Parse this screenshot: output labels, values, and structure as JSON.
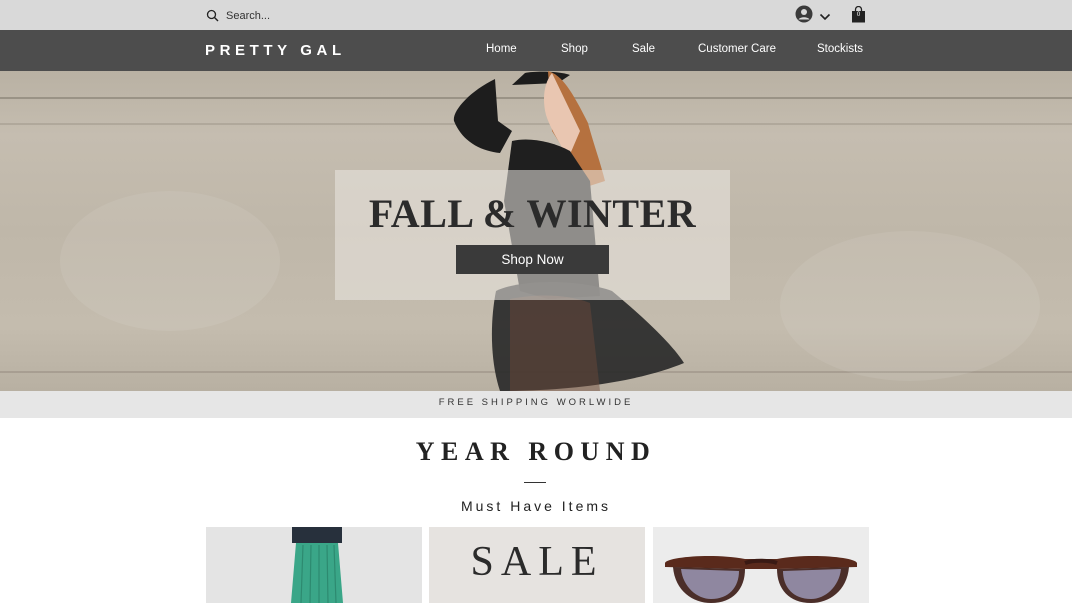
{
  "search": {
    "placeholder": "Search..."
  },
  "account": {
    "icon": "account-circle-icon",
    "dropdown_icon": "chevron-down-icon"
  },
  "cart": {
    "icon": "shopping-bag-icon",
    "count": "0"
  },
  "brand": {
    "name": "PRETTY GAL"
  },
  "nav": {
    "items": [
      {
        "label": "Home"
      },
      {
        "label": "Shop"
      },
      {
        "label": "Sale"
      },
      {
        "label": "Customer Care"
      },
      {
        "label": "Stockists"
      }
    ]
  },
  "hero": {
    "title": "FALL & WINTER",
    "cta_label": "Shop Now"
  },
  "shipping_banner": {
    "text": "FREE SHIPPING WORLWIDE"
  },
  "section": {
    "title": "YEAR ROUND",
    "subtitle": "Must Have Items"
  },
  "tiles": [
    {
      "image": "green-pleated-skirt"
    },
    {
      "label": "SALE"
    },
    {
      "image": "tortoiseshell-glasses"
    }
  ],
  "colors": {
    "topbar": "#d9d9d9",
    "navbar": "#4d4d4d",
    "button": "#3a3a3a",
    "banner": "#e6e6e6"
  }
}
